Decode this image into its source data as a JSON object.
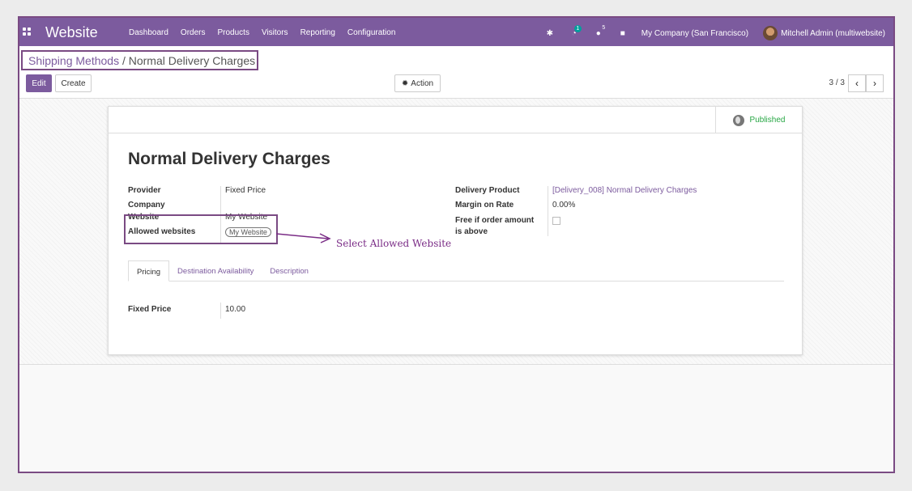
{
  "navbar": {
    "app_title": "Website",
    "menu": [
      "Dashboard",
      "Orders",
      "Products",
      "Visitors",
      "Reporting",
      "Configuration"
    ],
    "activity_badge": "1",
    "messages_badge": "5",
    "company": "My Company (San Francisco)",
    "user": "Mitchell Admin (multiwebsite)",
    "icons": [
      "apps-grid-icon",
      "bug-icon",
      "activity-clock-icon",
      "chat-icon",
      "gift-icon"
    ]
  },
  "breadcrumb": {
    "parent": "Shipping Methods",
    "separator": " / ",
    "current": "Normal Delivery Charges"
  },
  "buttons": {
    "edit": "Edit",
    "create": "Create",
    "action": "Action"
  },
  "pager": {
    "value": "3 / 3",
    "prev": "‹",
    "next": "›"
  },
  "status": {
    "published": "Published"
  },
  "record": {
    "title": "Normal Delivery Charges",
    "left_fields": [
      {
        "label": "Provider",
        "value": "Fixed Price"
      },
      {
        "label": "Company",
        "value": ""
      },
      {
        "label": "Website",
        "value": "My Website"
      },
      {
        "label": "Allowed websites",
        "value": "My Website"
      }
    ],
    "right_fields": [
      {
        "label": "Delivery Product",
        "value": "[Delivery_008] Normal Delivery Charges"
      },
      {
        "label": "Margin on Rate",
        "value": "0.00%"
      },
      {
        "label": "Free if order amount",
        "label2": "is above",
        "value": ""
      }
    ]
  },
  "annotation": "Select  Allowed  Website",
  "tabs": [
    "Pricing",
    "Destination Availability",
    "Description"
  ],
  "pricing": {
    "label": "Fixed Price",
    "value": "10.00"
  },
  "colors": {
    "brand": "#7c5b9e",
    "highlight": "#7a4a83",
    "published": "#28a745"
  }
}
